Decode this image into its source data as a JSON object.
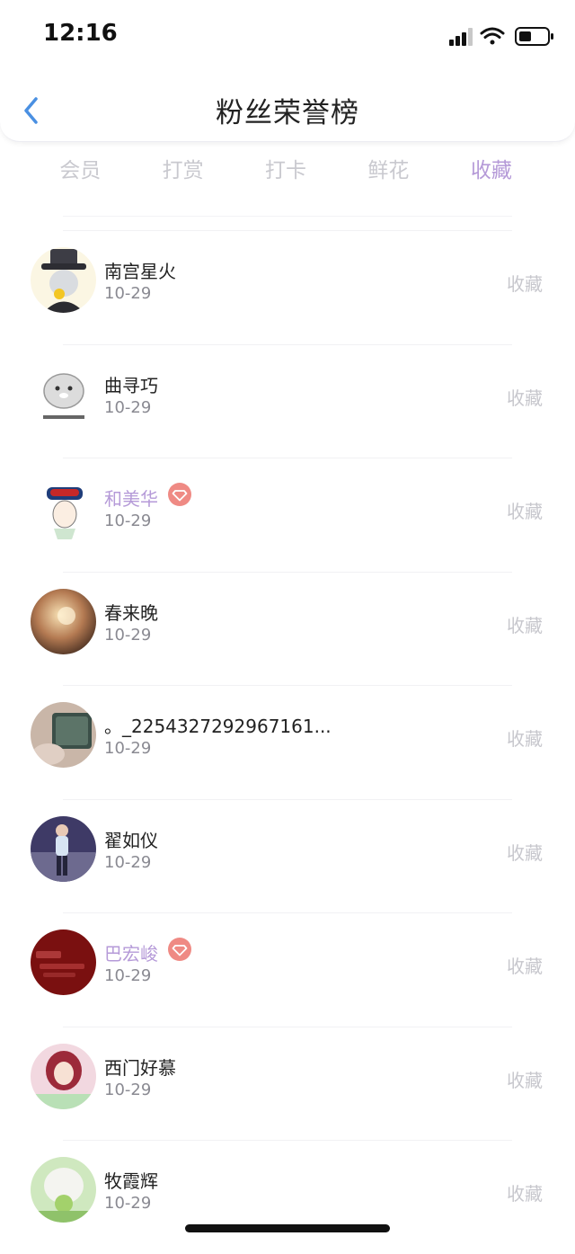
{
  "status": {
    "time": "12:16"
  },
  "header": {
    "title": "粉丝荣誉榜"
  },
  "tabs": [
    {
      "label": "会员",
      "active": false
    },
    {
      "label": "打赏",
      "active": false
    },
    {
      "label": "打卡",
      "active": false
    },
    {
      "label": "鲜花",
      "active": false
    },
    {
      "label": "收藏",
      "active": true
    }
  ],
  "colors": {
    "accent": "#b59ad8",
    "vip_badge": "#ef8a84",
    "muted": "#c7c7cd"
  },
  "fans": [
    {
      "name": "南宫星火",
      "date": "10-29",
      "action": "收藏",
      "vip": false
    },
    {
      "name": "曲寻巧",
      "date": "10-29",
      "action": "收藏",
      "vip": false
    },
    {
      "name": "和美华",
      "date": "10-29",
      "action": "收藏",
      "vip": true
    },
    {
      "name": "春来晚",
      "date": "10-29",
      "action": "收藏",
      "vip": false
    },
    {
      "name": "。_2254327292967161...",
      "date": "10-29",
      "action": "收藏",
      "vip": false
    },
    {
      "name": "翟如仪",
      "date": "10-29",
      "action": "收藏",
      "vip": false
    },
    {
      "name": "巴宏峻",
      "date": "10-29",
      "action": "收藏",
      "vip": true
    },
    {
      "name": "西门好慕",
      "date": "10-29",
      "action": "收藏",
      "vip": false
    },
    {
      "name": "牧霞辉",
      "date": "10-29",
      "action": "收藏",
      "vip": false
    }
  ]
}
